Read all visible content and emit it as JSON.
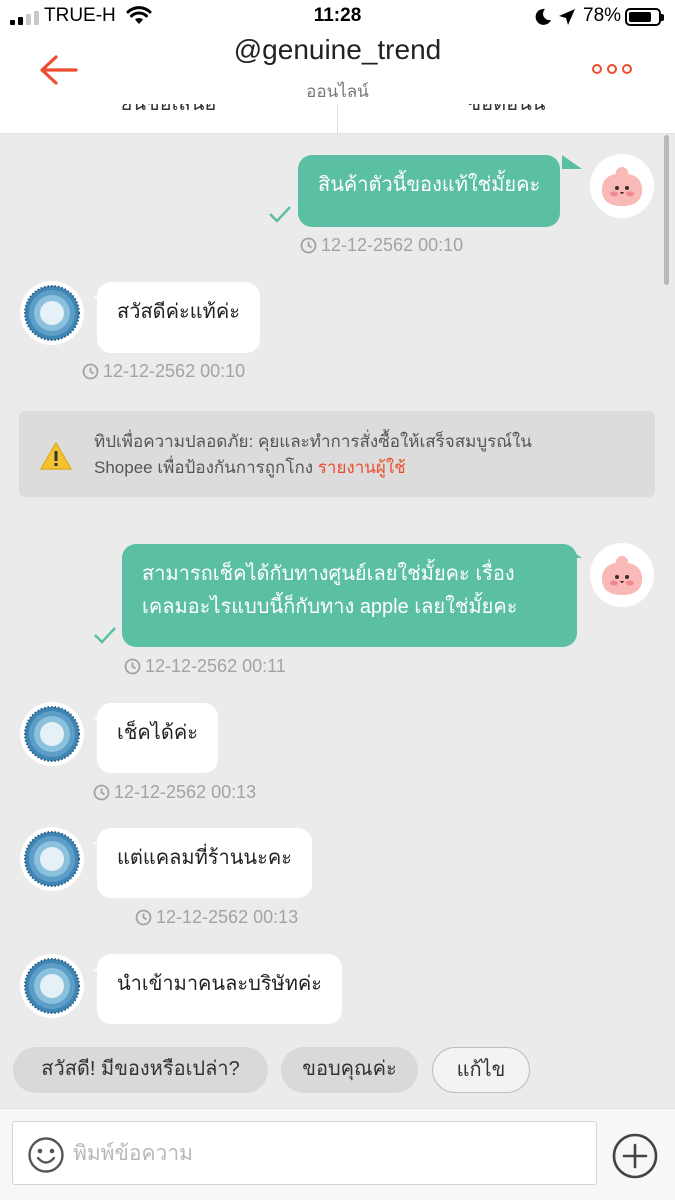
{
  "status_bar": {
    "carrier": "TRUE-H",
    "time": "11:28",
    "battery_percent": "78%",
    "battery_level": 0.78
  },
  "header": {
    "title": "@genuine_trend",
    "subtitle": "ออนไลน์"
  },
  "action_bar": {
    "left_label": "ยื่นข้อเสนอ",
    "right_label": "ซื้อตอนนี้"
  },
  "messages": [
    {
      "direction": "out",
      "text": "สินค้าตัวนี้ของแท้ใช่มั้ยคะ",
      "timestamp": "12-12-2562 00:10",
      "status": "read"
    },
    {
      "direction": "in",
      "text": "สวัสดีค่ะแท้ค่ะ",
      "timestamp": "12-12-2562 00:10"
    },
    {
      "direction": "out",
      "text_lines": [
        "สามารถเช็คได้กับทางศูนย์เลยใช่มั้ยคะ เรื่อง",
        "เคลมอะไรแบบนี้ก็กับทาง apple เลยใช่มั้ยคะ"
      ],
      "timestamp": "12-12-2562 00:11",
      "status": "read"
    },
    {
      "direction": "in",
      "text": "เช็คได้ค่ะ",
      "timestamp": "12-12-2562 00:13"
    },
    {
      "direction": "in",
      "text": "แต่แคลมที่ร้านนะคะ",
      "timestamp": "12-12-2562 00:13"
    },
    {
      "direction": "in",
      "text": "นำเข้ามาคนละบริษัทค่ะ"
    }
  ],
  "safety_tip": {
    "line1": "ทิปเพื่อความปลอดภัย: คุยและทำการสั่งซื้อให้เสร็จสมบูรณ์ใน",
    "line2": "Shopee เพื่อป้องกันการถูกโกง ",
    "link": "รายงานผู้ใช้"
  },
  "quick_replies": [
    "สวัสดี! มีของหรือเปล่า?",
    "ขอบคุณค่ะ",
    "แก้ไข"
  ],
  "composer": {
    "placeholder": "พิมพ์ข้อความ",
    "value": ""
  },
  "colors": {
    "accent": "#ee4d2d",
    "outgoing_bubble": "#5bbfa3",
    "incoming_bubble": "#ffffff",
    "chat_background": "#ebebeb"
  },
  "icons": [
    "back-arrow-icon",
    "more-options-icon",
    "read-check-icon",
    "clock-icon",
    "warning-icon",
    "emoji-icon",
    "plus-icon",
    "wifi-icon",
    "moon-icon",
    "location-icon"
  ]
}
